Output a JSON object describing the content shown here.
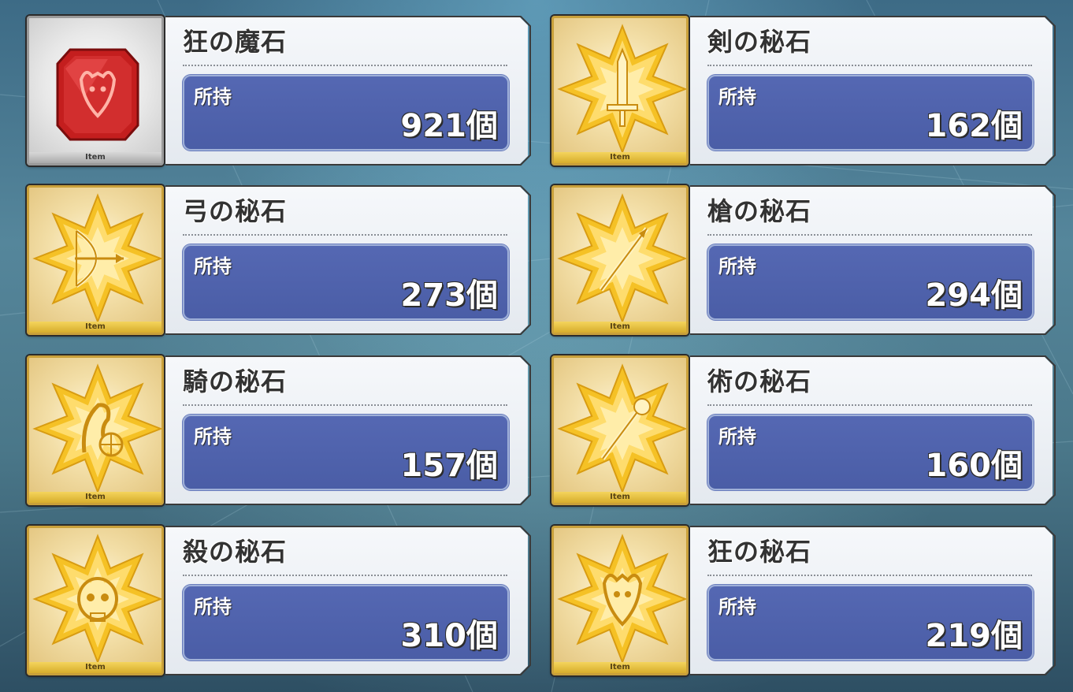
{
  "items": [
    {
      "name": "狂の魔石",
      "label": "所持",
      "count": "921個",
      "tag": "Item",
      "icon": "berserker-gem-icon",
      "frame": "silver"
    },
    {
      "name": "剣の秘石",
      "label": "所持",
      "count": "162個",
      "tag": "Item",
      "icon": "saber-gem-icon",
      "frame": "gold"
    },
    {
      "name": "弓の秘石",
      "label": "所持",
      "count": "273個",
      "tag": "Item",
      "icon": "archer-gem-icon",
      "frame": "gold"
    },
    {
      "name": "槍の秘石",
      "label": "所持",
      "count": "294個",
      "tag": "Item",
      "icon": "lancer-gem-icon",
      "frame": "gold"
    },
    {
      "name": "騎の秘石",
      "label": "所持",
      "count": "157個",
      "tag": "Item",
      "icon": "rider-gem-icon",
      "frame": "gold"
    },
    {
      "name": "術の秘石",
      "label": "所持",
      "count": "160個",
      "tag": "Item",
      "icon": "caster-gem-icon",
      "frame": "gold"
    },
    {
      "name": "殺の秘石",
      "label": "所持",
      "count": "310個",
      "tag": "Item",
      "icon": "assassin-gem-icon",
      "frame": "gold"
    },
    {
      "name": "狂の秘石",
      "label": "所持",
      "count": "219個",
      "tag": "Item",
      "icon": "berserker-secret-gem-icon",
      "frame": "gold"
    }
  ],
  "colors": {
    "count_box": "#5064b0",
    "gold_frame": "#c9a03a",
    "silver_frame": "#9a9a9a",
    "red_gem": "#c41e1e",
    "gold_gem": "#f5c125"
  }
}
